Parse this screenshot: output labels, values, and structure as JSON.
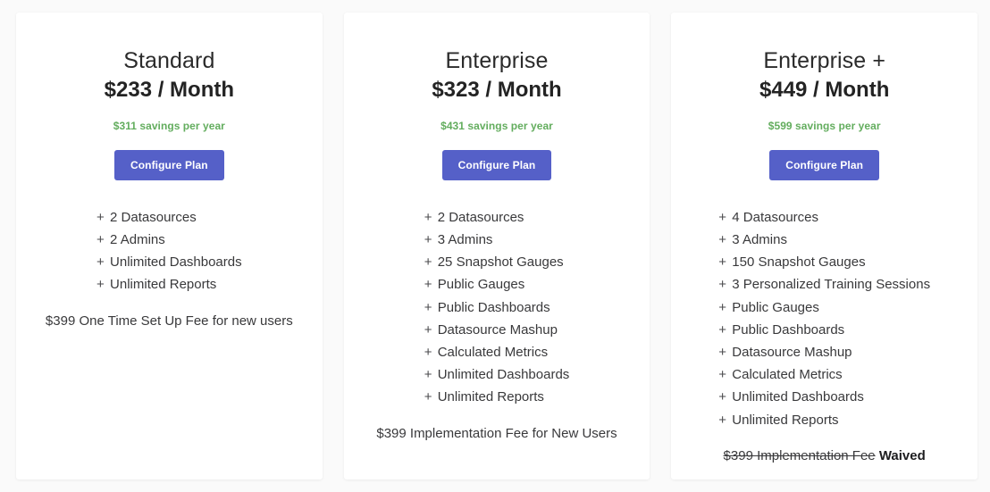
{
  "background_color": "#fafafa",
  "accent_color": "#5560c8",
  "savings_color": "#63ad5e",
  "text_color": "#39393b",
  "plans": [
    {
      "name": "Standard",
      "price": "$233 / Month",
      "savings": "$311 savings per year",
      "cta_label": "Configure Plan",
      "bullet_glyph": "+",
      "features": [
        "2 Datasources",
        "2 Admins",
        "Unlimited Dashboards",
        "Unlimited Reports"
      ],
      "footnote": {
        "struck_text": "",
        "plain_text": "$399 One Time Set Up Fee for new users",
        "bold_text": ""
      }
    },
    {
      "name": "Enterprise",
      "price": "$323 / Month",
      "savings": "$431 savings per year",
      "cta_label": "Configure Plan",
      "bullet_glyph": "+",
      "features": [
        "2 Datasources",
        "3 Admins",
        "25 Snapshot Gauges",
        "Public Gauges",
        "Public Dashboards",
        "Datasource Mashup",
        "Calculated Metrics",
        "Unlimited Dashboards",
        "Unlimited Reports"
      ],
      "footnote": {
        "struck_text": "",
        "plain_text": "$399 Implementation Fee for New Users",
        "bold_text": ""
      }
    },
    {
      "name": "Enterprise +",
      "price": "$449 / Month",
      "savings": "$599 savings per year",
      "cta_label": "Configure Plan",
      "bullet_glyph": "+",
      "features": [
        "4 Datasources",
        "3 Admins",
        "150 Snapshot Gauges",
        "3 Personalized Training Sessions",
        "Public Gauges",
        "Public Dashboards",
        "Datasource Mashup",
        "Calculated Metrics",
        "Unlimited Dashboards",
        "Unlimited Reports"
      ],
      "footnote": {
        "struck_text": "$399 Implementation Fee",
        "plain_text": "",
        "bold_text": "Waived"
      }
    }
  ]
}
